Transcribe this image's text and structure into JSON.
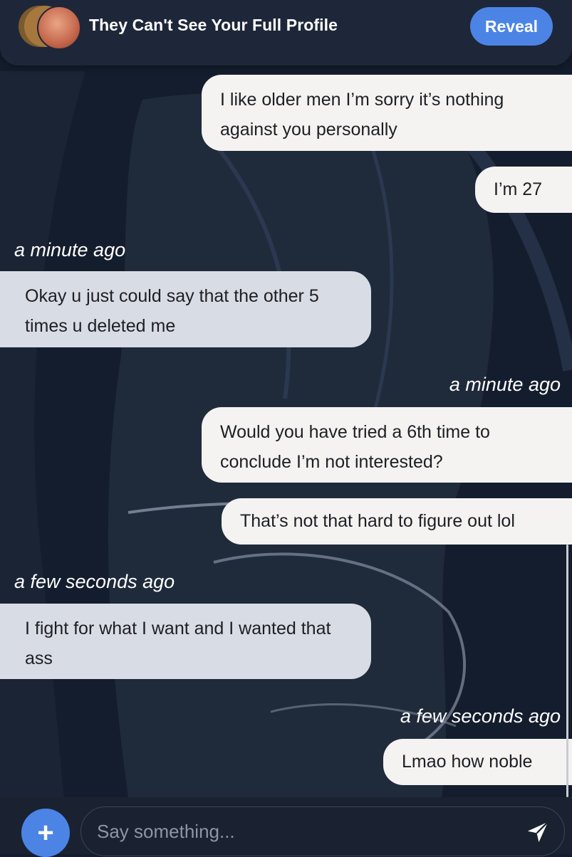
{
  "header": {
    "title": "They Can't See Your Full Profile",
    "reveal_label": "Reveal"
  },
  "messages": [
    {
      "side": "sent",
      "text": "I like older men I’m sorry it’s nothing against you personally"
    },
    {
      "side": "sent",
      "text": "I’m 27"
    },
    {
      "side": "received",
      "time": "a minute ago",
      "text": "Okay u just could say that the other 5 times u deleted me"
    },
    {
      "side": "sent",
      "time": "a minute ago",
      "text": "Would you have tried a 6th time to conclude I’m not interested?"
    },
    {
      "side": "sent",
      "text": "That’s not that hard to figure out lol"
    },
    {
      "side": "received",
      "time": "a few seconds ago",
      "text": "I fight for what I want and I wanted that ass"
    },
    {
      "side": "sent",
      "time": "a few seconds ago",
      "text": "Lmao how noble"
    }
  ],
  "composer": {
    "placeholder": "Say something...",
    "add_icon": "plus-icon",
    "send_icon": "send-icon"
  },
  "colors": {
    "accent": "#4c84e6",
    "sent_bubble": "#f4f3f1",
    "received_bubble": "#d8dce5",
    "background": "#141d2d"
  }
}
